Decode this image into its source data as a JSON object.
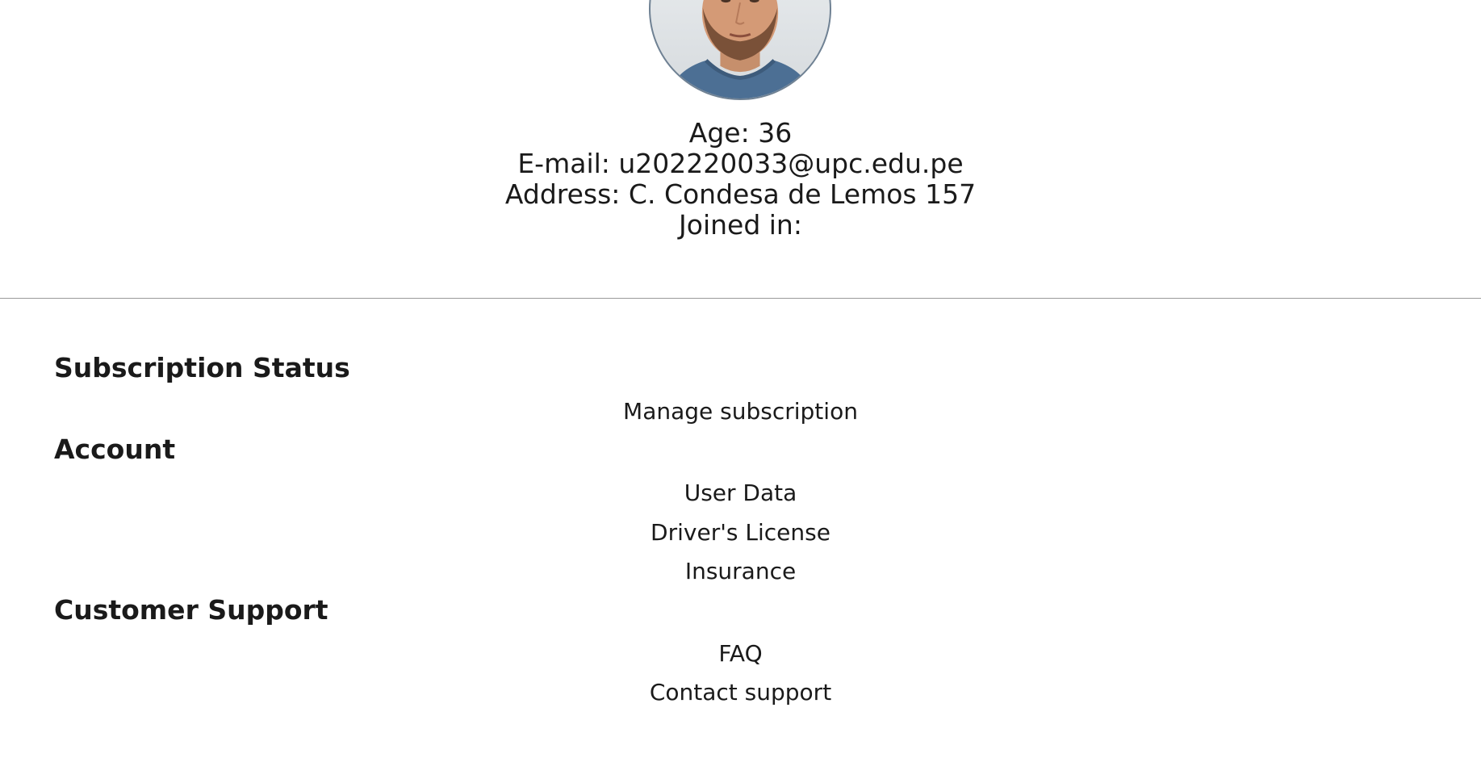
{
  "profile": {
    "age": "Age: 36",
    "email": "E-mail: u202220033@upc.edu.pe",
    "address": "Address: C. Condesa de Lemos 157",
    "joined": "Joined in:"
  },
  "sections": {
    "subscription": {
      "title": "Subscription Status",
      "links": [
        "Manage subscription"
      ]
    },
    "account": {
      "title": "Account",
      "links": [
        "User Data",
        "Driver's License",
        "Insurance"
      ]
    },
    "support": {
      "title": "Customer Support",
      "links": [
        "FAQ",
        "Contact support"
      ]
    }
  },
  "colors": {
    "text": "#1a1a1a",
    "divider": "#9a9a9a",
    "avatar_border": "#6f8193"
  }
}
